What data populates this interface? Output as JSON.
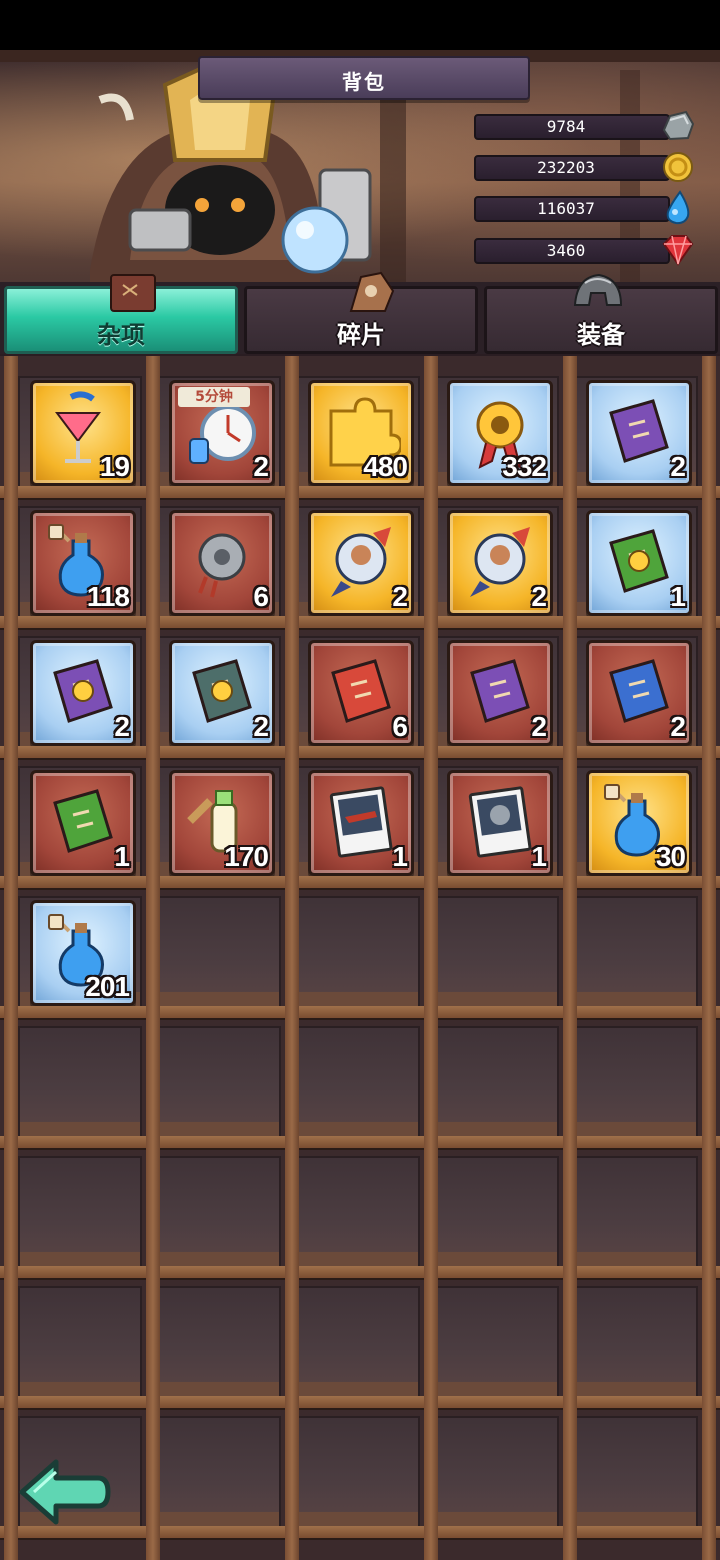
{
  "title": "背包",
  "resources": [
    {
      "name": "stone",
      "value": "9784",
      "icon": "stone-icon"
    },
    {
      "name": "gold",
      "value": "232203",
      "icon": "gold-coin-icon"
    },
    {
      "name": "water",
      "value": "116037",
      "icon": "water-drop-icon"
    },
    {
      "name": "gem",
      "value": "3460",
      "icon": "red-gem-icon"
    }
  ],
  "tabs": [
    {
      "label": "杂项",
      "active": true
    },
    {
      "label": "碎片",
      "active": false
    },
    {
      "label": "装备",
      "active": false
    }
  ],
  "items": [
    {
      "name": "cocktail",
      "rarity": "gold",
      "qty": "19"
    },
    {
      "name": "clock-potion",
      "rarity": "red",
      "qty": "2",
      "badge": "5分钟"
    },
    {
      "name": "puzzle-piece",
      "rarity": "gold",
      "qty": "480"
    },
    {
      "name": "gear-medal",
      "rarity": "blue",
      "qty": "332"
    },
    {
      "name": "purple-book-upgrade",
      "rarity": "blue",
      "qty": "2"
    },
    {
      "name": "blue-potion-tag",
      "rarity": "red",
      "qty": "118"
    },
    {
      "name": "gear-shard",
      "rarity": "red",
      "qty": "6"
    },
    {
      "name": "knight-shield",
      "rarity": "gold",
      "qty": "2"
    },
    {
      "name": "knight-shield",
      "rarity": "gold",
      "qty": "2"
    },
    {
      "name": "green-gear-book",
      "rarity": "blue",
      "qty": "1"
    },
    {
      "name": "purple-gear-book",
      "rarity": "blue",
      "qty": "2"
    },
    {
      "name": "teal-gear-book",
      "rarity": "blue",
      "qty": "2"
    },
    {
      "name": "red-book",
      "rarity": "red",
      "qty": "6"
    },
    {
      "name": "purple-book",
      "rarity": "red",
      "qty": "2"
    },
    {
      "name": "blue-book",
      "rarity": "red",
      "qty": "2"
    },
    {
      "name": "green-book",
      "rarity": "red",
      "qty": "1"
    },
    {
      "name": "milk-bottle",
      "rarity": "red",
      "qty": "170"
    },
    {
      "name": "photo-card-gun",
      "rarity": "red",
      "qty": "1"
    },
    {
      "name": "photo-card-robot",
      "rarity": "red",
      "qty": "1"
    },
    {
      "name": "blue-potion-tag",
      "rarity": "gold",
      "qty": "30"
    },
    {
      "name": "blue-potion-flask",
      "rarity": "blue",
      "qty": "201"
    }
  ],
  "colors": {
    "gold": "#f5b528",
    "red": "#a2463a",
    "blue": "#a9cff2",
    "tab_active": "#2bc9a4"
  }
}
